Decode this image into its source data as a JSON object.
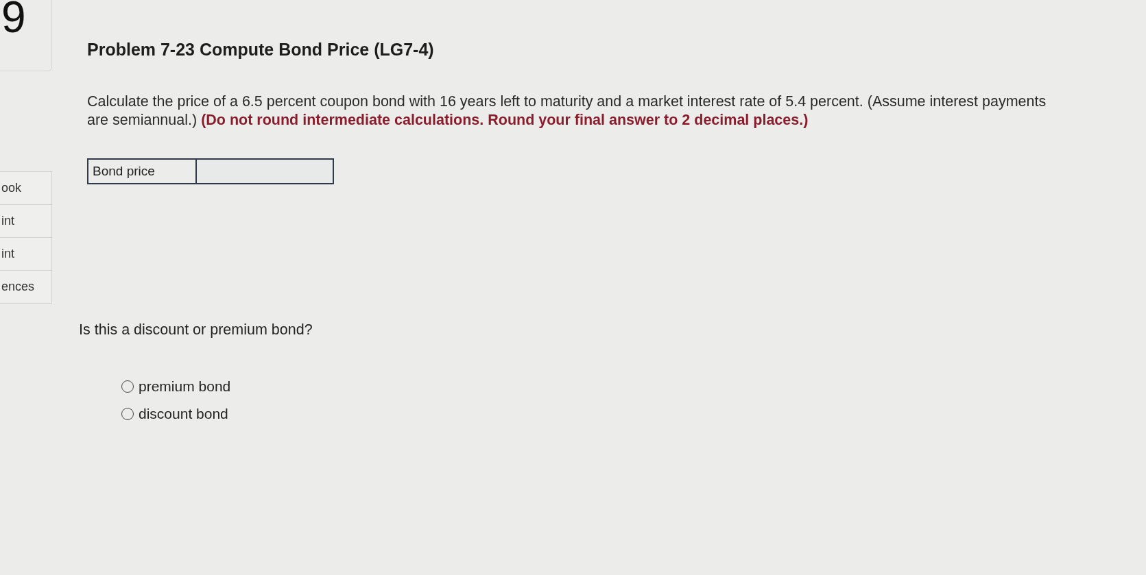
{
  "question_number": "9",
  "title": "Problem 7-23 Compute Bond Price (LG7-4)",
  "sidebar": {
    "items": [
      {
        "label": "ook"
      },
      {
        "label": "int"
      },
      {
        "label": "int"
      },
      {
        "label": "ences"
      }
    ]
  },
  "prompt": "Calculate the price of a 6.5 percent coupon bond with 16 years left to maturity and a market interest rate of 5.4 percent. (Assume interest payments are semiannual.) **(Do not round intermediate calculations. Round your final answer to 2 decimal places.)**",
  "answer_table": {
    "label": "Bond price"
  },
  "question": "Is this a discount or premium bond?",
  "options": [
    {
      "label": "premium bond",
      "selected": false
    },
    {
      "label": "discount bond",
      "selected": false
    }
  ]
}
